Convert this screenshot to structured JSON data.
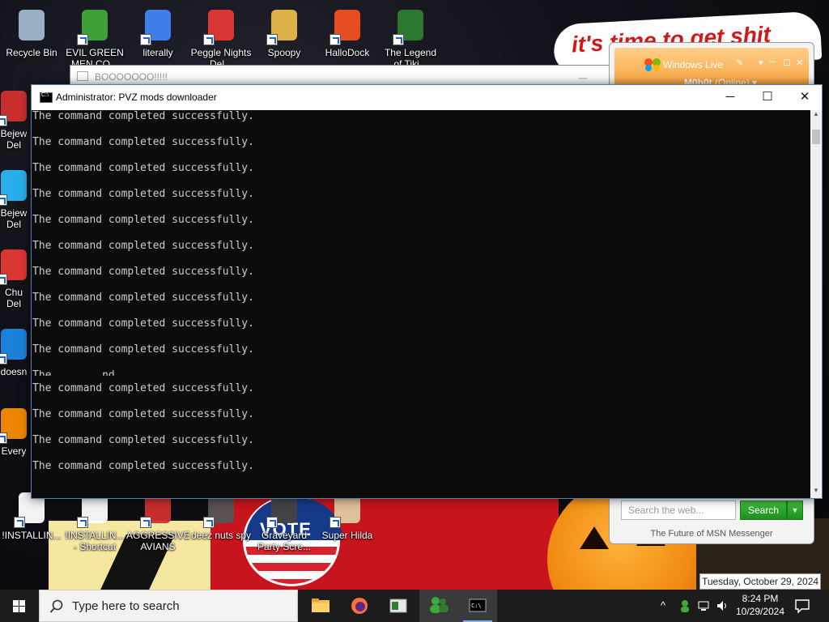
{
  "desktop": {
    "icons_top": [
      {
        "label": "Recycle Bin",
        "label2": "",
        "icon": "recycle-bin-icon",
        "color": "#9fb7cf"
      },
      {
        "label": "EVIL GREEN",
        "label2": "MEN CO...",
        "icon": "green-men-icon",
        "color": "#3fa83a"
      },
      {
        "label": "literally",
        "label2": "",
        "icon": "chrome-icon",
        "color": "#4285f4"
      },
      {
        "label": "Peggle Nights",
        "label2": "Del...",
        "icon": "peggle-icon",
        "color": "#e53935"
      },
      {
        "label": "Spoopy",
        "label2": "",
        "icon": "folder-zip-icon",
        "color": "#e8b84a"
      },
      {
        "label": "HalloDock",
        "label2": "",
        "icon": "windows-logo-icon",
        "color": "#f25022"
      },
      {
        "label": "The Legend",
        "label2": "of Tiki...",
        "icon": "game-character-icon",
        "color": "#2e7d32"
      }
    ],
    "icons_left": [
      {
        "label": "Bejew",
        "label2": "Del",
        "icon": "bejeweled-icon",
        "color": "#d32f2f"
      },
      {
        "label": "Bejew",
        "label2": "Del",
        "icon": "bejeweled-icon",
        "color": "#29b6f6"
      },
      {
        "label": "Chu",
        "label2": "Del",
        "icon": "chuzzle-icon",
        "color": "#e53935"
      },
      {
        "label": "doesn",
        "label2": "",
        "icon": "app-icon",
        "color": "#1e88e5"
      },
      {
        "label": "Every",
        "label2": "",
        "icon": "app-icon",
        "color": "#fb8c00"
      }
    ],
    "icons_bottom": [
      {
        "label": "!INSTALLIN...",
        "label2": "",
        "icon": "document-icon",
        "color": "#ffffff"
      },
      {
        "label": "!INSTALLIN...",
        "label2": "- Shortcut",
        "icon": "document-icon",
        "color": "#ffffff"
      },
      {
        "label": "AGGRESSIVE",
        "label2": "AVIANS",
        "icon": "angry-bird-icon",
        "color": "#d32f2f"
      },
      {
        "label": "deez nuts spy",
        "label2": "",
        "icon": "app-icon",
        "color": "#555555"
      },
      {
        "label": "Graveyard",
        "label2": "Party Scre...",
        "icon": "graveyard-icon",
        "color": "#444444"
      },
      {
        "label": "Super Hilda",
        "label2": "",
        "icon": "pixel-character-icon",
        "color": "#e0c9a0"
      }
    ]
  },
  "wallpaper": {
    "banner_text": "it's time to get shit",
    "vote_text": "VOTE"
  },
  "background_window": {
    "title": "BOOOOOOO!!!!!"
  },
  "msn": {
    "header_title": "Windows Live",
    "username": "M0b0t",
    "status": "(Online)",
    "search_placeholder": "Search the web...",
    "search_button": "Search",
    "footer": "The Future of MSN Messenger"
  },
  "cmd": {
    "title": "Administrator:  PVZ mods downloader",
    "lines": [
      "The command completed successfully.",
      "",
      "The command completed successfully.",
      "",
      "The command completed successfully.",
      "",
      "The command completed successfully.",
      "",
      "The command completed successfully.",
      "",
      "The command completed successfully.",
      "",
      "The command completed successfully.",
      "",
      "The command completed successfully.",
      "",
      "The command completed successfully.",
      "",
      "The command completed successfully.",
      "",
      "The command completed successfully.",
      "",
      "The command completed successfully.",
      "",
      "The command completed successfully.",
      "",
      "The command completed successfully."
    ],
    "partial_line": "The        nd",
    "controls": {
      "minimize": "─",
      "maximize": "☐",
      "close": "✕"
    }
  },
  "tooltip": {
    "date_long": "Tuesday, October 29, 2024"
  },
  "taskbar": {
    "search_placeholder": "Type here to search",
    "time": "8:24 PM",
    "date": "10/29/2024",
    "tray_chevron": "^"
  }
}
